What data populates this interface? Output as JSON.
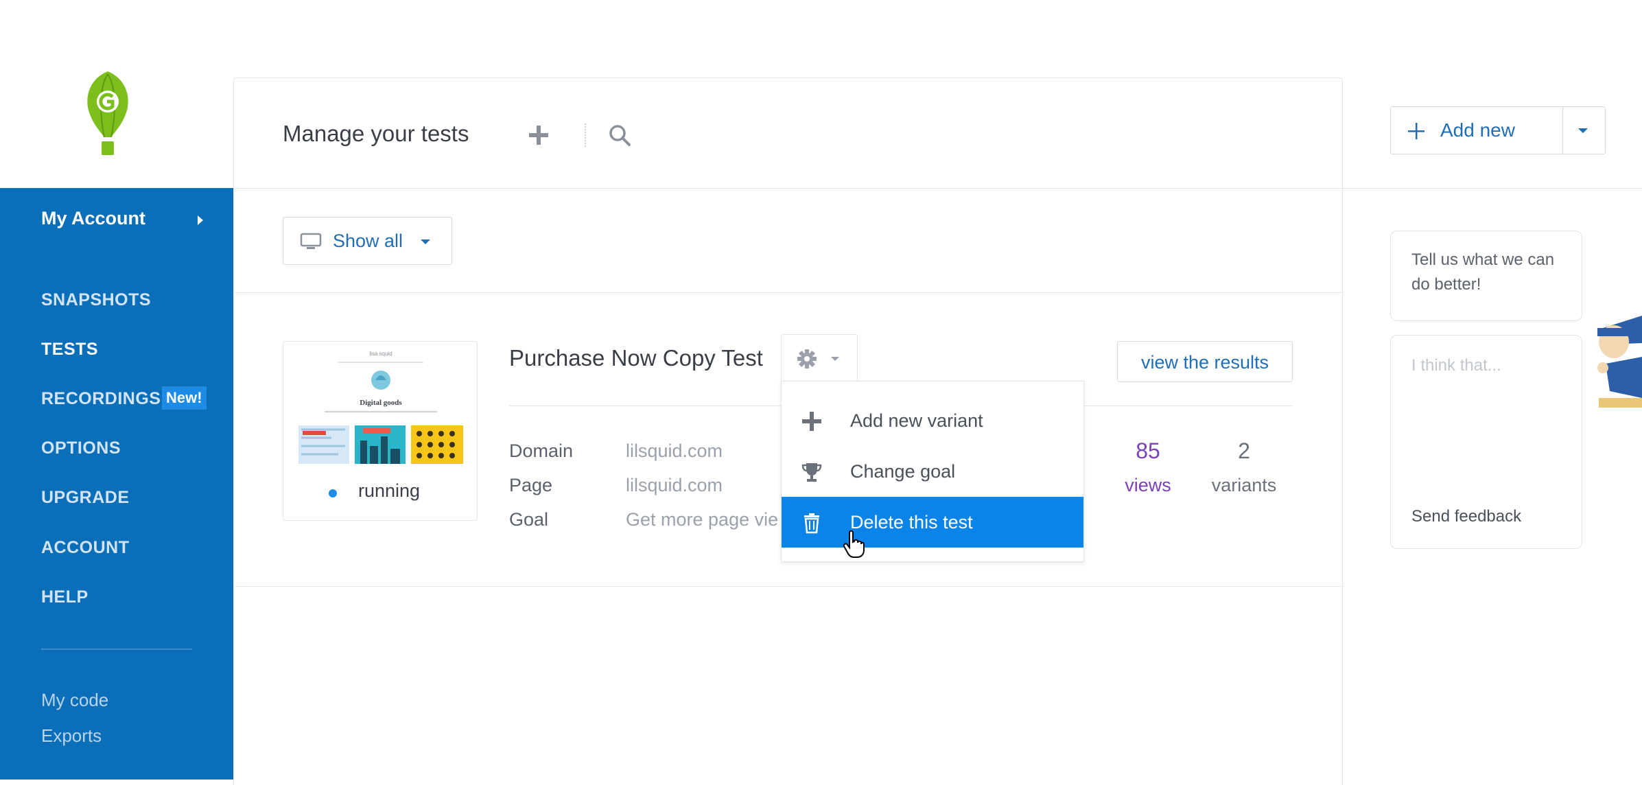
{
  "sidebar": {
    "account_label": "My Account",
    "nav": [
      {
        "label": "SNAPSHOTS"
      },
      {
        "label": "TESTS"
      },
      {
        "label": "RECORDINGS"
      },
      {
        "label": "OPTIONS"
      },
      {
        "label": "UPGRADE"
      },
      {
        "label": "ACCOUNT"
      },
      {
        "label": "HELP"
      }
    ],
    "new_badge": "New!",
    "links": [
      {
        "label": "My code"
      },
      {
        "label": "Exports"
      }
    ]
  },
  "header": {
    "title": "Manage your tests",
    "add_icon": "plus-icon",
    "search_icon": "search-icon"
  },
  "filter": {
    "label": "Show all",
    "icon": "monitor-icon"
  },
  "test": {
    "title": "Purchase Now Copy Test",
    "status": "running",
    "info": [
      {
        "key": "Domain",
        "value": "lilsquid.com"
      },
      {
        "key": "Page",
        "value": "lilsquid.com"
      },
      {
        "key": "Goal",
        "value": "Get more page vie"
      }
    ],
    "view_results": "view the results",
    "views_count": "85",
    "views_label": "views",
    "variants_count": "2",
    "variants_label": "variants",
    "thumbnail": {
      "brand": "lisa squid",
      "headline": "Digital goods"
    }
  },
  "menu": {
    "items": [
      {
        "label": "Add new variant",
        "icon": "plus-icon"
      },
      {
        "label": "Change goal",
        "icon": "trophy-icon"
      },
      {
        "label": "Delete this test",
        "icon": "trash-icon"
      }
    ]
  },
  "right": {
    "add_new": "Add new",
    "feedback_prompt": "Tell us what we can do better!",
    "feedback_placeholder": "I think that...",
    "send_feedback": "Send feedback"
  },
  "colors": {
    "sidebar": "#0a6fb8",
    "accent": "#1f6eb5",
    "highlight": "#0a84e8",
    "views_purple": "#7b3fb8",
    "logo_green": "#7cbf1c"
  }
}
